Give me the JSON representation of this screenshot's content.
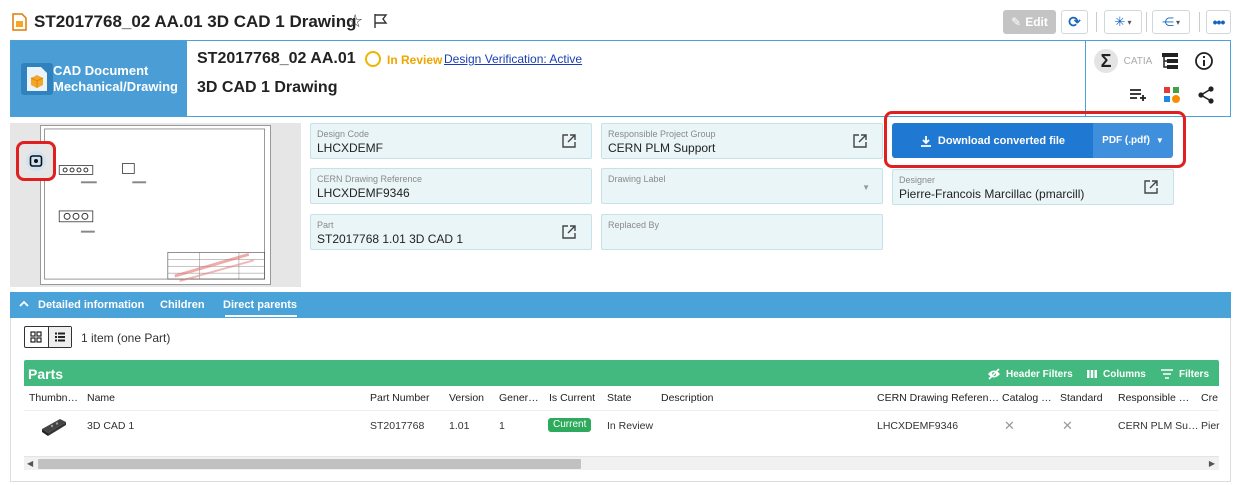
{
  "title_bar": {
    "title": "ST2017768_02 AA.01 3D CAD 1 Drawing",
    "edit_label": "Edit"
  },
  "header": {
    "type_line1": "CAD Document",
    "type_line2": "Mechanical/Drawing",
    "name": "ST2017768_02  AA.01",
    "status": "In Review",
    "workflow_link": "Design Verification: Active",
    "subtitle": "3D CAD 1 Drawing"
  },
  "fields": {
    "design_code": {
      "label": "Design Code",
      "value": "LHCXDEMF"
    },
    "responsible_group": {
      "label": "Responsible Project Group",
      "value": "CERN PLM Support"
    },
    "drawing_reference": {
      "label": "CERN Drawing Reference",
      "value": "LHCXDEMF9346"
    },
    "drawing_label": {
      "label": "Drawing Label",
      "value": ""
    },
    "designer": {
      "label": "Designer",
      "value": "Pierre-Francois Marcillac (pmarcill)"
    },
    "part": {
      "label": "Part",
      "value": "ST2017768 1.01 3D CAD 1"
    },
    "replaced_by": {
      "label": "Replaced By",
      "value": ""
    }
  },
  "download": {
    "label": "Download converted file",
    "format": "PDF (.pdf)"
  },
  "tabs": [
    "Detailed information",
    "Children",
    "Direct parents"
  ],
  "active_tab": "Direct parents",
  "list": {
    "count_text": "1 item (one Part)"
  },
  "parts_table": {
    "title": "Parts",
    "tools": {
      "header_filters": "Header Filters",
      "columns": "Columns",
      "filters": "Filters"
    },
    "columns": [
      "Thumbn…",
      "Name",
      "Part Number",
      "Version",
      "Gener…",
      "Is Current",
      "State",
      "Description",
      "CERN Drawing Referen…",
      "Catalog …",
      "Standard",
      "Responsible …",
      "Cre"
    ],
    "rows": [
      {
        "name": "3D CAD 1",
        "part_number": "ST2017768",
        "version": "1.01",
        "generation": "1",
        "is_current": "Current",
        "state": "In Review",
        "description": "",
        "drawing_reference": "LHCXDEMF9346",
        "responsible": "CERN PLM Su…",
        "creator": "Pier"
      }
    ]
  },
  "colors": {
    "primary_blue": "#4aa3d8",
    "download_blue": "#1f78d1",
    "parts_green": "#43b97f",
    "status_amber": "#f0b400",
    "highlight_red": "#e02020"
  }
}
